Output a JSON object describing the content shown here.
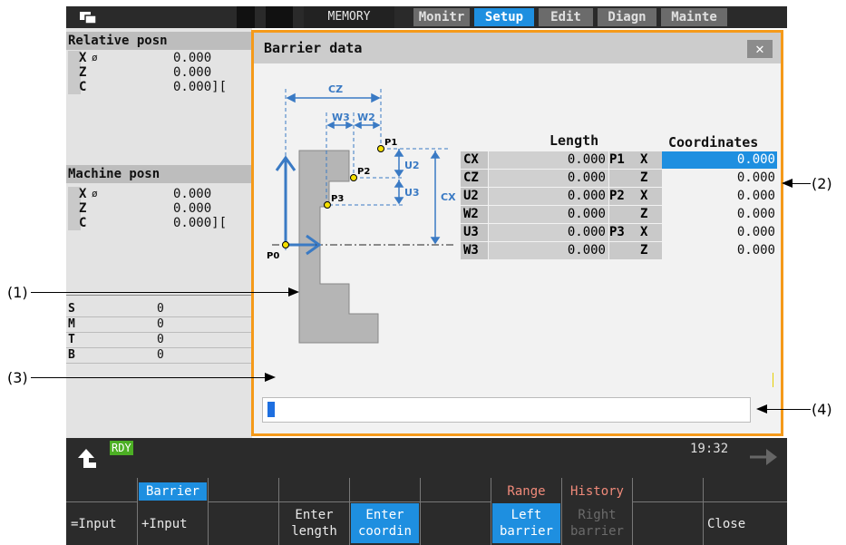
{
  "topbar": {
    "mode": "MEMORY",
    "tabs": [
      "Monitr",
      "Setup",
      "Edit",
      "Diagn",
      "Mainte"
    ],
    "active_tab": "Setup"
  },
  "relative": {
    "title": "Relative posn",
    "rows": [
      {
        "axis": "X",
        "mark": "ø",
        "value": "0.000"
      },
      {
        "axis": "Z",
        "mark": "",
        "value": "0.000"
      },
      {
        "axis": "C",
        "mark": "",
        "value": "0.000]["
      }
    ]
  },
  "machine": {
    "title": "Machine posn",
    "rows": [
      {
        "axis": "X",
        "mark": "ø",
        "value": "0.000"
      },
      {
        "axis": "Z",
        "mark": "",
        "value": "0.000"
      },
      {
        "axis": "C",
        "mark": "",
        "value": "0.000]["
      }
    ]
  },
  "smtb": [
    {
      "label": "S",
      "value": "0"
    },
    {
      "label": "M",
      "value": "0"
    },
    {
      "label": "T",
      "value": "0"
    },
    {
      "label": "B",
      "value": "0"
    }
  ],
  "dialog": {
    "title": "Barrier data",
    "close": "✕",
    "col_length": "Length",
    "col_coords": "Coordinates",
    "rows": [
      {
        "label": "CX",
        "length": "0.000",
        "point": "P1",
        "axis": "X",
        "coord": "0.000"
      },
      {
        "label": "CZ",
        "length": "0.000",
        "point": "",
        "axis": "Z",
        "coord": "0.000"
      },
      {
        "label": "U2",
        "length": "0.000",
        "point": "P2",
        "axis": "X",
        "coord": "0.000"
      },
      {
        "label": "W2",
        "length": "0.000",
        "point": "",
        "axis": "Z",
        "coord": "0.000"
      },
      {
        "label": "U3",
        "length": "0.000",
        "point": "P3",
        "axis": "X",
        "coord": "0.000"
      },
      {
        "label": "W3",
        "length": "0.000",
        "point": "",
        "axis": "Z",
        "coord": "0.000"
      }
    ],
    "diagram": {
      "cz": "CZ",
      "w3": "W3",
      "w2": "W2",
      "u2": "U2",
      "u3": "U3",
      "cx": "CX",
      "p0": "P0",
      "p1": "P1",
      "p2": "P2",
      "p3": "P3"
    }
  },
  "callouts": [
    "(1)",
    "(2)",
    "(3)",
    "(4)"
  ],
  "status": {
    "rdy": "RDY",
    "time": "19:32"
  },
  "fkeys": [
    {
      "top": "",
      "main": "=Input"
    },
    {
      "top": "Barrier",
      "main": "+Input"
    },
    {
      "top": "",
      "main": ""
    },
    {
      "top": "",
      "main": "Enter\nlength"
    },
    {
      "top": "",
      "main": "Enter\ncoordin"
    },
    {
      "top": "",
      "main": ""
    },
    {
      "top": "Range",
      "main": "Left\nbarrier"
    },
    {
      "top": "History",
      "main": "Right\nbarrier"
    },
    {
      "top": "",
      "main": ""
    },
    {
      "top": "",
      "main": "Close"
    }
  ],
  "colors": {
    "accent": "#1e8fe0",
    "dialog_border": "#f59a1a",
    "rdy": "#4caf24"
  }
}
